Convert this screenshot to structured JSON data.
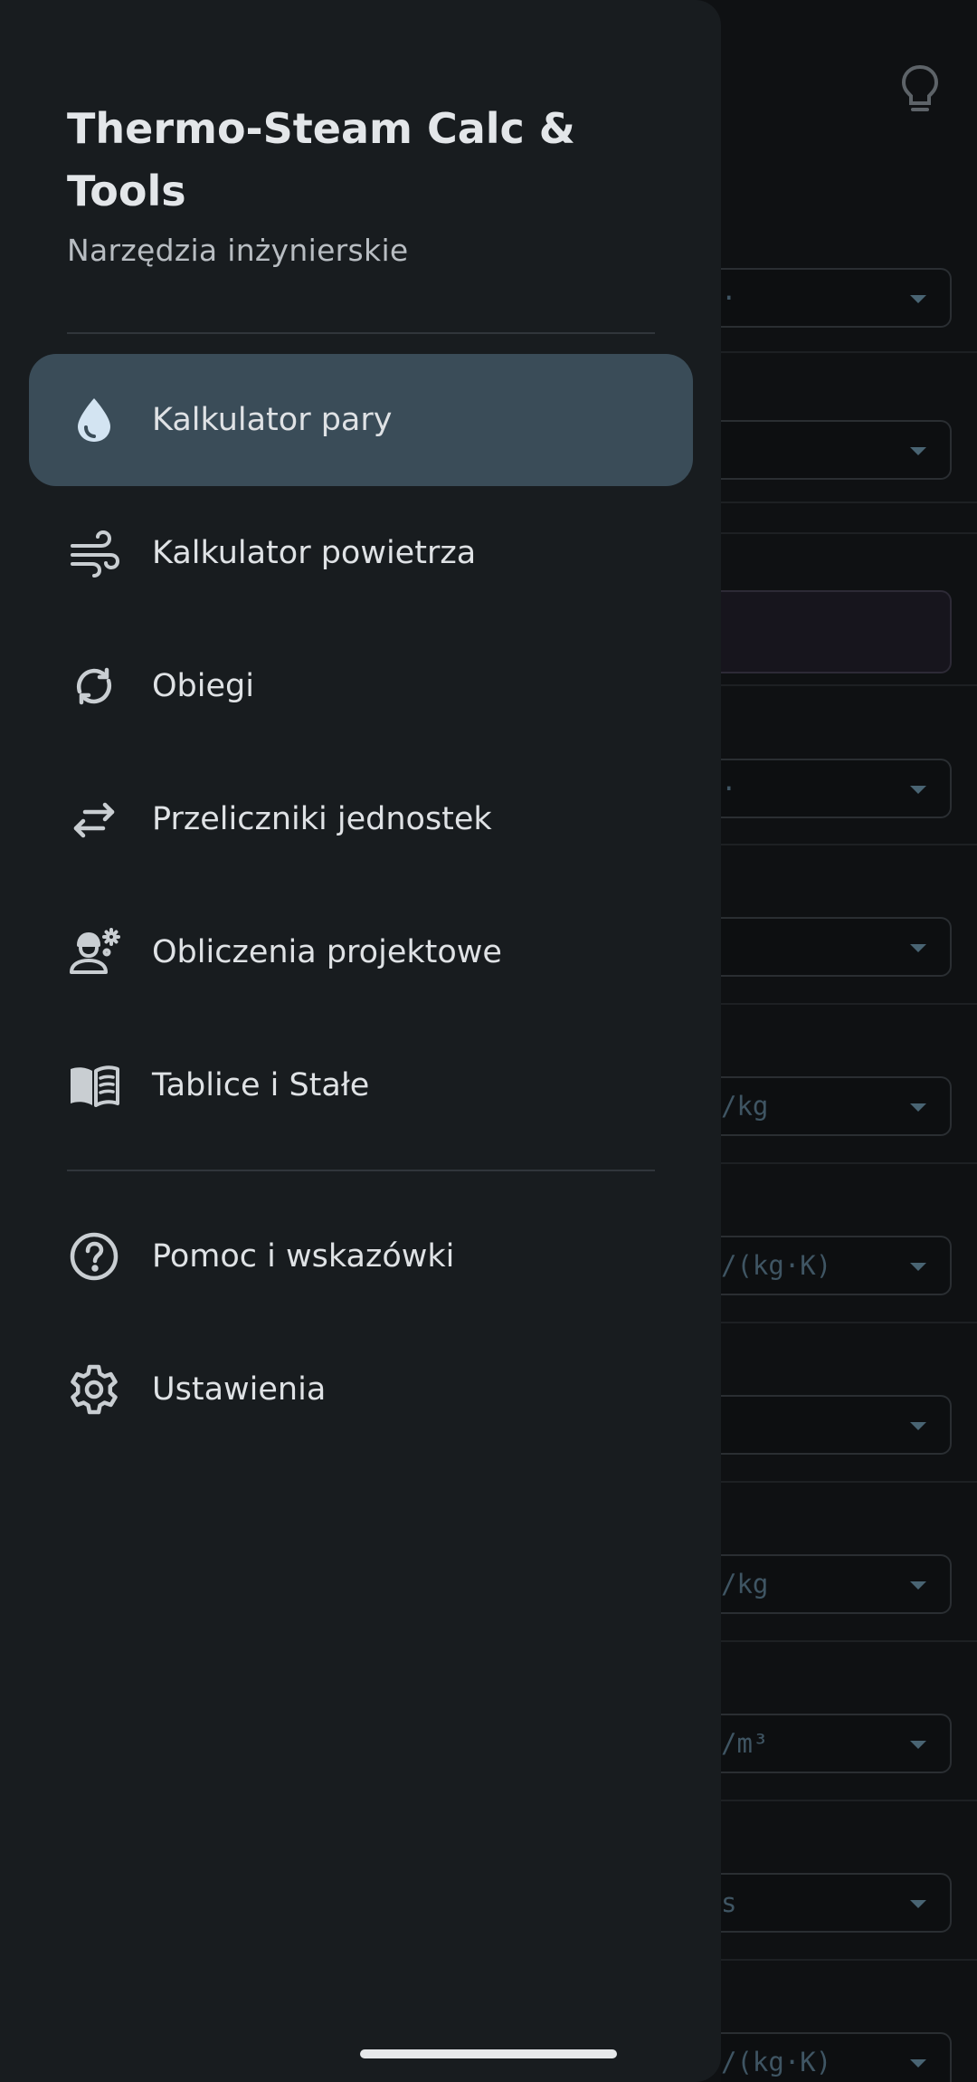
{
  "drawer": {
    "title": "Thermo-Steam Calc & Tools",
    "subtitle": "Narzędzia inżynierskie",
    "primary_items": [
      {
        "label": "Kalkulator pary",
        "icon": "water-drop-icon",
        "active": true
      },
      {
        "label": "Kalkulator powietrza",
        "icon": "air-icon",
        "active": false
      },
      {
        "label": "Obiegi",
        "icon": "cycle-icon",
        "active": false
      },
      {
        "label": "Przeliczniki jednostek",
        "icon": "swap-arrows-icon",
        "active": false
      },
      {
        "label": "Obliczenia projektowe",
        "icon": "engineer-icon",
        "active": false
      },
      {
        "label": "Tablice i Stałe",
        "icon": "open-book-icon",
        "active": false
      }
    ],
    "secondary_items": [
      {
        "label": "Pomoc i wskazówki",
        "icon": "help-circle-icon"
      },
      {
        "label": "Ustawienia",
        "icon": "gear-icon"
      }
    ]
  },
  "background": {
    "top_icon": "lightbulb-icon",
    "field_texts": [
      "·",
      "",
      "",
      "·",
      "",
      "/kg",
      "/(kg·K)",
      "",
      "/kg",
      "/m³",
      "s",
      "/(kg·K)"
    ]
  },
  "colors": {
    "drawer_bg": "#181c1f",
    "active_item_bg": "#3a4c58",
    "active_icon": "#d3e4f2",
    "text_primary": "#dfe2e5",
    "text_secondary": "#b8bdc2"
  }
}
